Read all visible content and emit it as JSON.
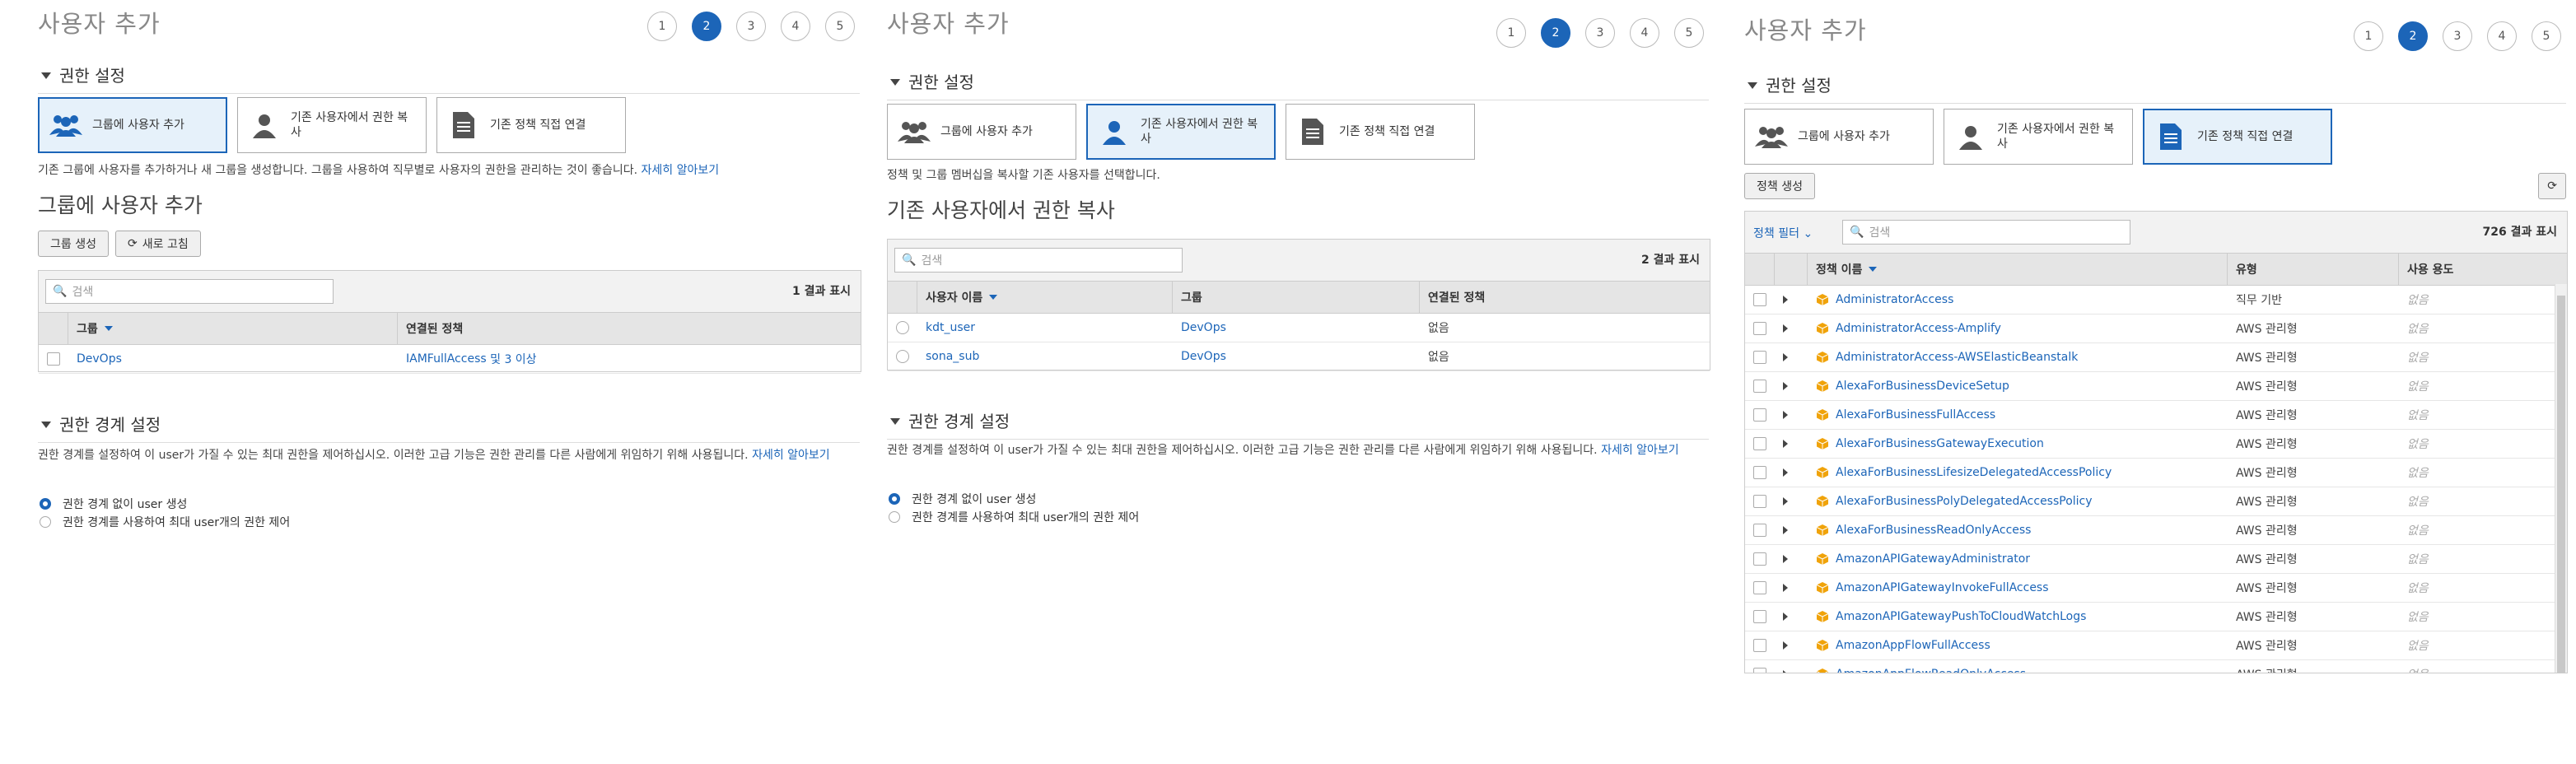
{
  "panels": [
    {
      "title": "사용자 추가",
      "steps": [
        "1",
        "2",
        "3",
        "4",
        "5"
      ],
      "active_step": "2",
      "permissions_section": "권한 설정",
      "options": [
        {
          "label": "그룹에 사용자 추가",
          "icon": "group-icon",
          "selected": true
        },
        {
          "label": "기존 사용자에서 권한 복사",
          "icon": "user-icon",
          "selected": false
        },
        {
          "label": "기존 정책 직접 연결",
          "icon": "document-icon",
          "selected": false
        }
      ],
      "description": "기존 그룹에 사용자를 추가하거나 새 그룹을 생성합니다. 그룹을 사용하여 직무별로 사용자의 권한을 관리하는 것이 좋습니다.",
      "description_link": "자세히 알아보기",
      "subsection_title": "그룹에 사용자 추가",
      "create_group_button": "그룹 생성",
      "refresh_button": "새로 고침",
      "search_placeholder": "검색",
      "result_count": "1 결과 표시",
      "columns": [
        "그룹",
        "연결된 정책"
      ],
      "rows": [
        {
          "group": "DevOps",
          "policies_link": "IAMFullAccess",
          "policies_suffix": "및 3 이상"
        }
      ],
      "boundary_section": "권한 경계 설정",
      "boundary_description": "권한 경계를 설정하여 이 user가 가질 수 있는 최대 권한을 제어하십시오. 이러한 고급 기능은 권한 관리를 다른 사람에게 위임하기 위해 사용됩니다.",
      "boundary_link": "자세히 알아보기",
      "radio_options": [
        {
          "label": "권한 경계 없이 user 생성",
          "checked": true
        },
        {
          "label": "권한 경계를 사용하여 최대 user개의 권한 제어",
          "checked": false
        }
      ]
    },
    {
      "title": "사용자 추가",
      "steps": [
        "1",
        "2",
        "3",
        "4",
        "5"
      ],
      "active_step": "2",
      "permissions_section": "권한 설정",
      "options": [
        {
          "label": "그룹에 사용자 추가",
          "icon": "group-icon",
          "selected": false
        },
        {
          "label": "기존 사용자에서 권한 복사",
          "icon": "user-icon",
          "selected": true
        },
        {
          "label": "기존 정책 직접 연결",
          "icon": "document-icon",
          "selected": false
        }
      ],
      "description": "정책 및 그룹 멤버십을 복사할 기존 사용자를 선택합니다.",
      "subsection_title": "기존 사용자에서 권한 복사",
      "search_placeholder": "검색",
      "result_count": "2 결과 표시",
      "columns": [
        "사용자 이름",
        "그룹",
        "연결된 정책"
      ],
      "rows": [
        {
          "user": "kdt_user",
          "group": "DevOps",
          "policy": "없음"
        },
        {
          "user": "sona_sub",
          "group": "DevOps",
          "policy": "없음"
        }
      ],
      "boundary_section": "권한 경계 설정",
      "boundary_description": "권한 경계를 설정하여 이 user가 가질 수 있는 최대 권한을 제어하십시오. 이러한 고급 기능은 권한 관리를 다른 사람에게 위임하기 위해 사용됩니다.",
      "boundary_link": "자세히 알아보기",
      "radio_options": [
        {
          "label": "권한 경계 없이 user 생성",
          "checked": true
        },
        {
          "label": "권한 경계를 사용하여 최대 user개의 권한 제어",
          "checked": false
        }
      ]
    },
    {
      "title": "사용자 추가",
      "steps": [
        "1",
        "2",
        "3",
        "4",
        "5"
      ],
      "active_step": "2",
      "permissions_section": "권한 설정",
      "options": [
        {
          "label": "그룹에 사용자 추가",
          "icon": "group-icon",
          "selected": false
        },
        {
          "label": "기존 사용자에서 권한 복사",
          "icon": "user-icon",
          "selected": false
        },
        {
          "label": "기존 정책 직접 연결",
          "icon": "document-icon",
          "selected": true
        }
      ],
      "create_policy_button": "정책 생성",
      "filter_label": "정책 필터",
      "search_placeholder": "검색",
      "result_count": "726 결과 표시",
      "columns": [
        "정책 이름",
        "유형",
        "사용 용도"
      ],
      "rows": [
        {
          "name": "AdministratorAccess",
          "type": "직무 기반",
          "usage": "없음"
        },
        {
          "name": "AdministratorAccess-Amplify",
          "type": "AWS 관리형",
          "usage": "없음"
        },
        {
          "name": "AdministratorAccess-AWSElasticBeanstalk",
          "type": "AWS 관리형",
          "usage": "없음"
        },
        {
          "name": "AlexaForBusinessDeviceSetup",
          "type": "AWS 관리형",
          "usage": "없음"
        },
        {
          "name": "AlexaForBusinessFullAccess",
          "type": "AWS 관리형",
          "usage": "없음"
        },
        {
          "name": "AlexaForBusinessGatewayExecution",
          "type": "AWS 관리형",
          "usage": "없음"
        },
        {
          "name": "AlexaForBusinessLifesizeDelegatedAccessPolicy",
          "type": "AWS 관리형",
          "usage": "없음"
        },
        {
          "name": "AlexaForBusinessPolyDelegatedAccessPolicy",
          "type": "AWS 관리형",
          "usage": "없음"
        },
        {
          "name": "AlexaForBusinessReadOnlyAccess",
          "type": "AWS 관리형",
          "usage": "없음"
        },
        {
          "name": "AmazonAPIGatewayAdministrator",
          "type": "AWS 관리형",
          "usage": "없음"
        },
        {
          "name": "AmazonAPIGatewayInvokeFullAccess",
          "type": "AWS 관리형",
          "usage": "없음"
        },
        {
          "name": "AmazonAPIGatewayPushToCloudWatchLogs",
          "type": "AWS 관리형",
          "usage": "없음"
        },
        {
          "name": "AmazonAppFlowFullAccess",
          "type": "AWS 관리형",
          "usage": "없음"
        },
        {
          "name": "AmazonAppFlowReadOnlyAccess",
          "type": "AWS 관리형",
          "usage": "없음"
        }
      ]
    }
  ],
  "colors": {
    "accent": "#1c65b8",
    "selected_bg": "#e6f1fa",
    "policy_icon": "#f0a30a"
  }
}
